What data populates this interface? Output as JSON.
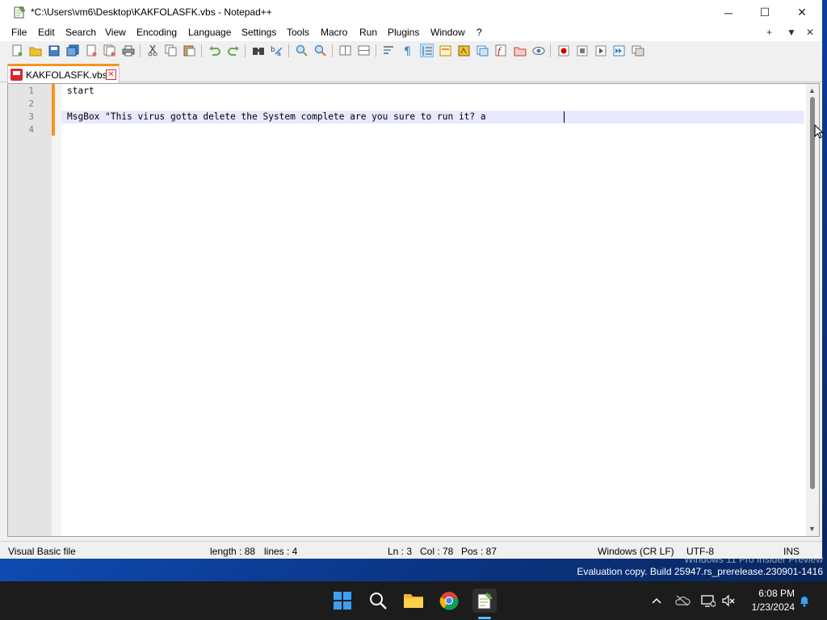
{
  "window": {
    "title": "*C:\\Users\\vm6\\Desktop\\KAKFOLASFK.vbs - Notepad++",
    "minimize": "─",
    "maximize": "☐",
    "close": "✕"
  },
  "menu": {
    "items": [
      "File",
      "Edit",
      "Search",
      "View",
      "Encoding",
      "Language",
      "Settings",
      "Tools",
      "Macro",
      "Run",
      "Plugins",
      "Window",
      "?"
    ],
    "right": [
      "+",
      "▼",
      "✕"
    ]
  },
  "tab": {
    "label": "KAKFOLASFK.vbs",
    "close": "✕"
  },
  "editor": {
    "line_numbers": [
      "1",
      "2",
      "3",
      "4"
    ],
    "lines": [
      "start",
      "",
      "MsgBox \"This virus gotta delete the System complete are you sure to run it? a",
      ""
    ],
    "scroll_up": "▲",
    "scroll_down": "▼"
  },
  "status": {
    "file_type": "Visual Basic file",
    "length": "length : 88",
    "lines": "lines : 4",
    "ln": "Ln : 3",
    "col": "Col : 78",
    "pos": "Pos : 87",
    "eol": "Windows (CR LF)",
    "encoding": "UTF-8",
    "mode": "INS"
  },
  "watermark": {
    "line1": "Windows 11 Pro Insider Preview",
    "line2": "Evaluation copy. Build 25947.rs_prerelease.230901-1416"
  },
  "taskbar": {
    "time": "6:08 PM",
    "date": "1/23/2024"
  },
  "colors": {
    "accent": "#f7941d",
    "tab_icon": "#d8282e",
    "current_line": "#e8e8ff",
    "taskbar": "#1c1c1c"
  }
}
